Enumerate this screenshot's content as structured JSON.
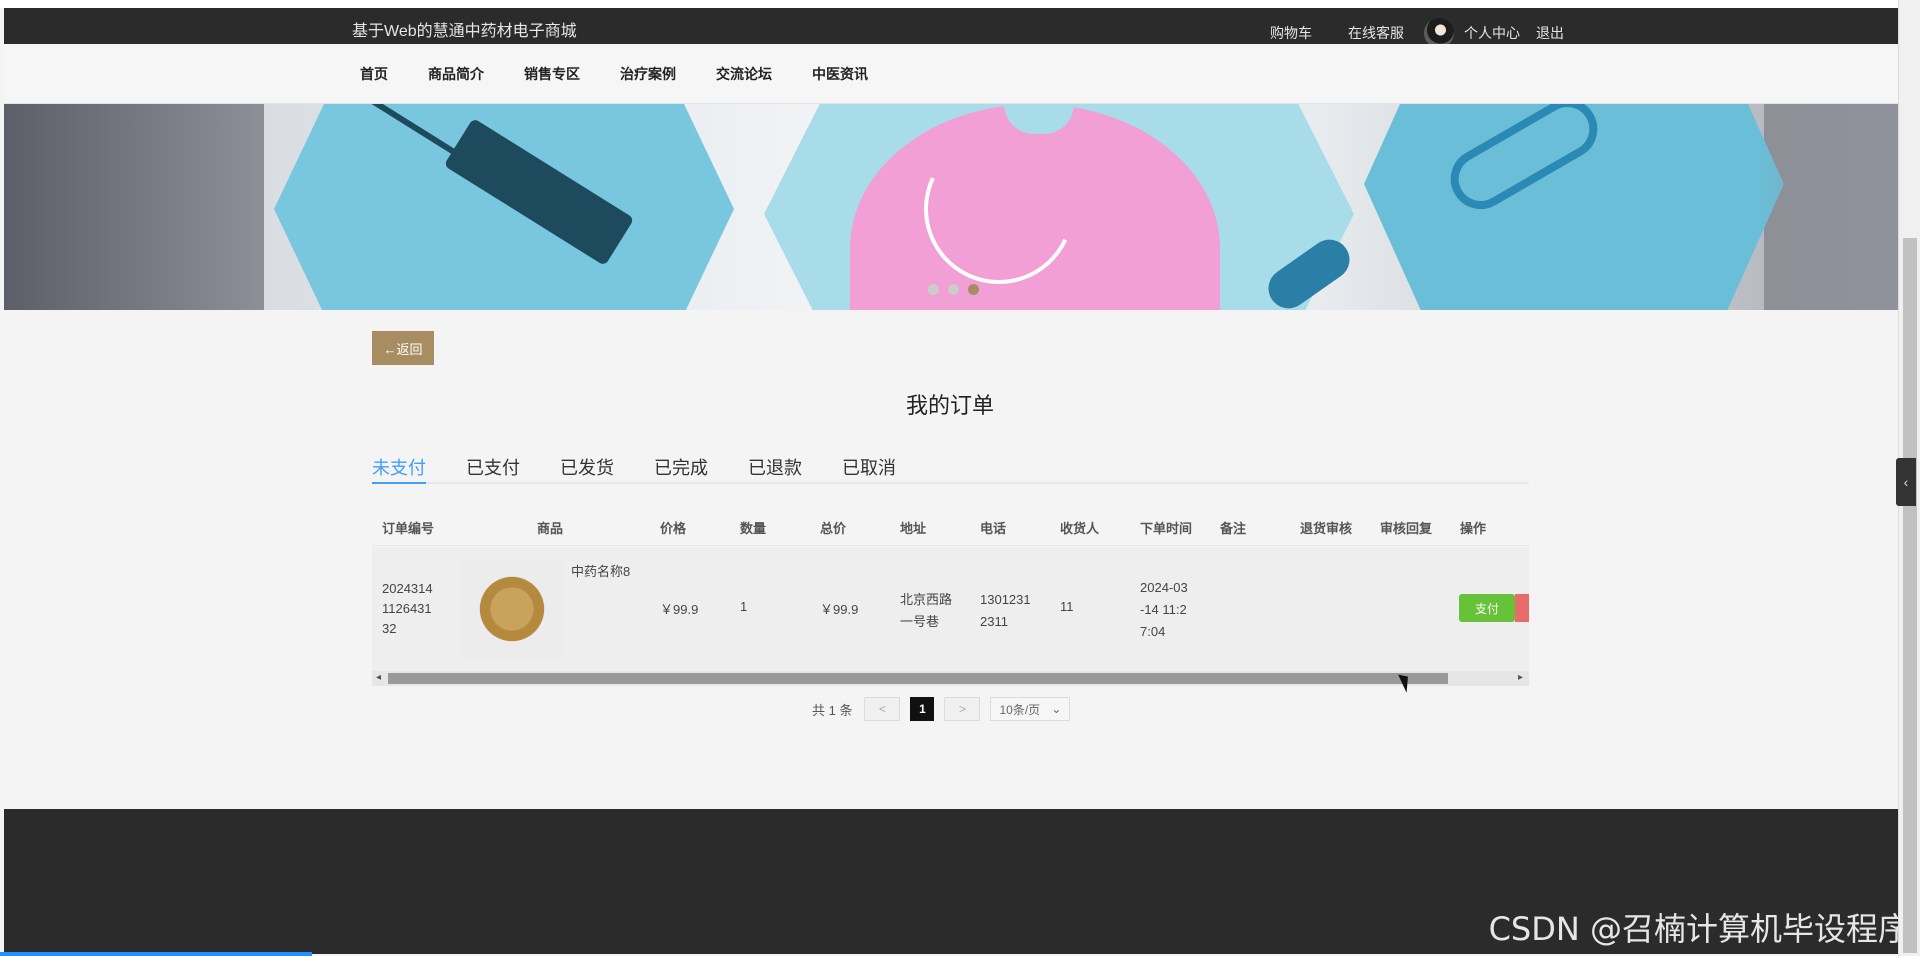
{
  "header": {
    "site_title": "基于Web的慧通中药材电子商城",
    "cart": "购物车",
    "service": "在线客服",
    "profile": "个人中心",
    "logout": "退出"
  },
  "nav": {
    "items": [
      "首页",
      "商品简介",
      "销售专区",
      "治疗案例",
      "交流论坛",
      "中医资讯"
    ]
  },
  "back_button": "←返回",
  "page_title": "我的订单",
  "tabs": [
    "未支付",
    "已支付",
    "已发货",
    "已完成",
    "已退款",
    "已取消"
  ],
  "table": {
    "headers": [
      "订单编号",
      "商品",
      "价格",
      "数量",
      "总价",
      "地址",
      "电话",
      "收货人",
      "下单时间",
      "备注",
      "退货审核",
      "审核回复",
      "操作"
    ],
    "rows": [
      {
        "order_no_lines": [
          "2024314",
          "1126431",
          "32"
        ],
        "product_name": "中药名称8",
        "price": "￥99.9",
        "quantity": "1",
        "total": "￥99.9",
        "address_lines": [
          "北京西路",
          "一号巷"
        ],
        "phone_lines": [
          "1301231",
          "2311"
        ],
        "receiver": "11",
        "time_lines": [
          "2024-03",
          "-14 11:2",
          "7:04"
        ],
        "remark": "",
        "refund_review": "",
        "review_reply": "",
        "pay_label": "支付"
      }
    ]
  },
  "pager": {
    "total_text": "共 1 条",
    "prev": "<",
    "current": "1",
    "next": ">",
    "page_size": "10条/页"
  },
  "watermark": "CSDN @召楠计算机毕设程序",
  "colors": {
    "accent_brown": "#a88d63",
    "tab_active": "#409eff",
    "pay_green": "#67c23a",
    "delete_red": "#e86a6a",
    "dark_bar": "#2b2b2b"
  }
}
